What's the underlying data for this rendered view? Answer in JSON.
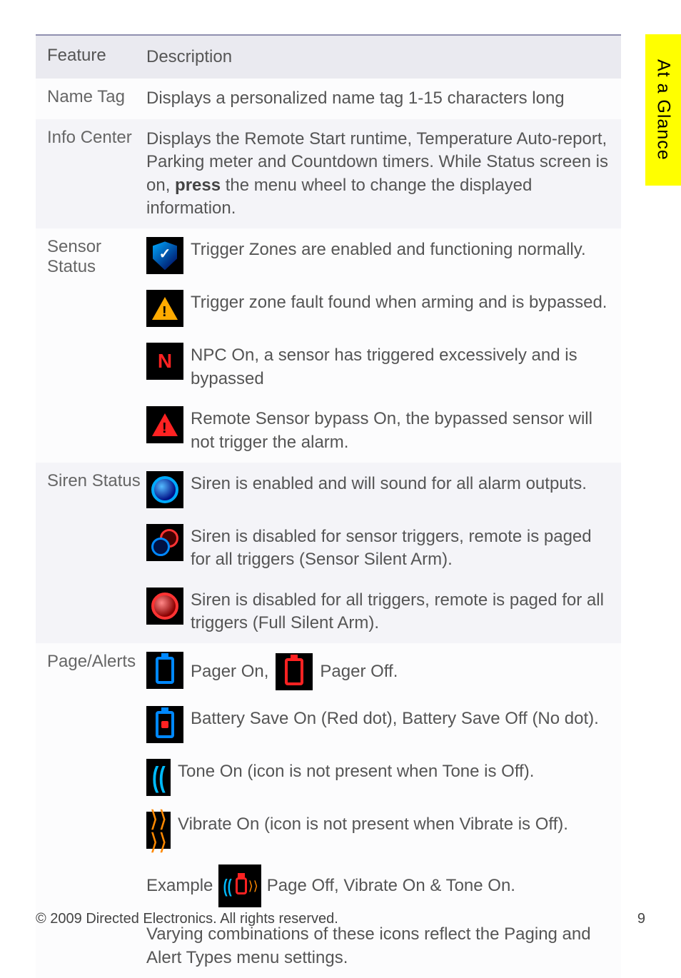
{
  "side_tab": "At a Glance",
  "header": {
    "feature": "Feature",
    "description": "Description"
  },
  "rows": {
    "name_tag": {
      "label": "Name Tag",
      "desc": "Displays a personalized name tag 1-15 characters long"
    },
    "info_center": {
      "label": "Info Center",
      "desc_pre": "Displays the Remote Start runtime, Temperature Auto-report, Parking meter and Countdown timers. While Status screen is on, ",
      "desc_bold": "press",
      "desc_post": " the menu wheel to change the displayed information."
    },
    "sensor_status": {
      "label": "Sensor Status",
      "items": [
        "Trigger Zones are enabled and functioning normally.",
        "Trigger zone fault found when arming and is bypassed.",
        "NPC On, a sensor has triggered excessively and is bypassed",
        "Remote Sensor bypass On, the bypassed sensor will not trigger the alarm."
      ]
    },
    "siren_status": {
      "label": "Siren Status",
      "items": [
        "Siren is enabled and will sound for all alarm outputs.",
        "Siren is disabled for sensor triggers, remote is paged for all triggers (Sensor Silent Arm).",
        "Siren is disabled for all triggers, remote is paged for all triggers (Full Silent Arm)."
      ]
    },
    "page_alerts": {
      "label": "Page/Alerts",
      "pager_on": "Pager On,",
      "pager_off": "Pager Off.",
      "battery": "Battery Save On (Red dot), Battery Save Off (No dot).",
      "tone": "Tone On (icon is not present when Tone is Off).",
      "vibrate": "Vibrate On (icon is not present when Vibrate is Off).",
      "example_label": "Example",
      "example_text": "Page Off, Vibrate On & Tone On.",
      "footer": "Varying combinations of these icons reflect the Paging and Alert Types menu settings."
    }
  },
  "footer": {
    "copyright": "© 2009 Directed Electronics. All rights reserved.",
    "page": "9"
  }
}
